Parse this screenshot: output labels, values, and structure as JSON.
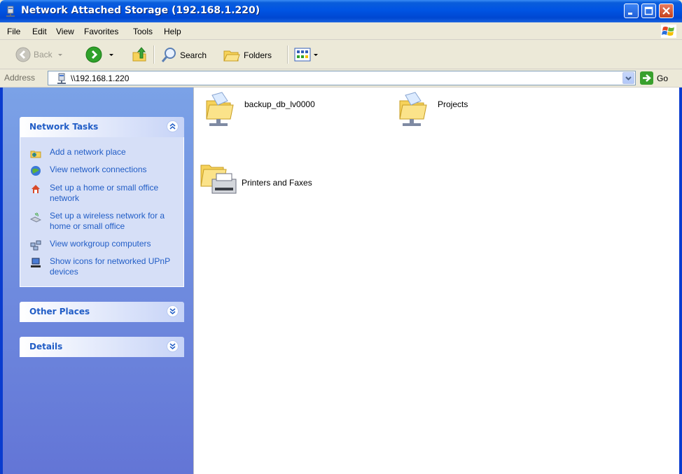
{
  "window": {
    "title": "Network Attached Storage (192.168.1.220)",
    "buttons": [
      "minimize-button",
      "maximize-button",
      "close-button"
    ]
  },
  "menu": {
    "items": [
      "File",
      "Edit",
      "View",
      "Favorites",
      "Tools",
      "Help"
    ]
  },
  "toolbar": {
    "back_label": "Back",
    "search_label": "Search",
    "folders_label": "Folders"
  },
  "address": {
    "label": "Address",
    "value": "\\\\192.168.1.220",
    "go_label": "Go"
  },
  "sidebar": {
    "network_tasks": {
      "title": "Network Tasks",
      "items": [
        {
          "label": "Add a network place",
          "icon": "add-network-place-icon"
        },
        {
          "label": "View network connections",
          "icon": "network-connections-icon"
        },
        {
          "label": "Set up a home or small office network",
          "icon": "home-network-icon"
        },
        {
          "label": "Set up a wireless network for a home or small office",
          "icon": "wireless-network-icon"
        },
        {
          "label": "View workgroup computers",
          "icon": "workgroup-computers-icon"
        },
        {
          "label": "Show icons for networked UPnP devices",
          "icon": "upnp-devices-icon"
        }
      ]
    },
    "other_places": {
      "title": "Other Places"
    },
    "details": {
      "title": "Details"
    }
  },
  "content": {
    "items": [
      {
        "label": "backup_db_lv0000",
        "icon": "shared-folder-icon"
      },
      {
        "label": "Projects",
        "icon": "shared-folder-icon"
      },
      {
        "label": "Printers and Faxes",
        "icon": "printers-folder-icon"
      }
    ]
  },
  "colors": {
    "titlebar": "#0054e3",
    "sidebar_top": "#7ba2e7",
    "sidebar_bottom": "#6375d6",
    "task_link": "#215dc6",
    "panel_body": "#d6dff7"
  }
}
